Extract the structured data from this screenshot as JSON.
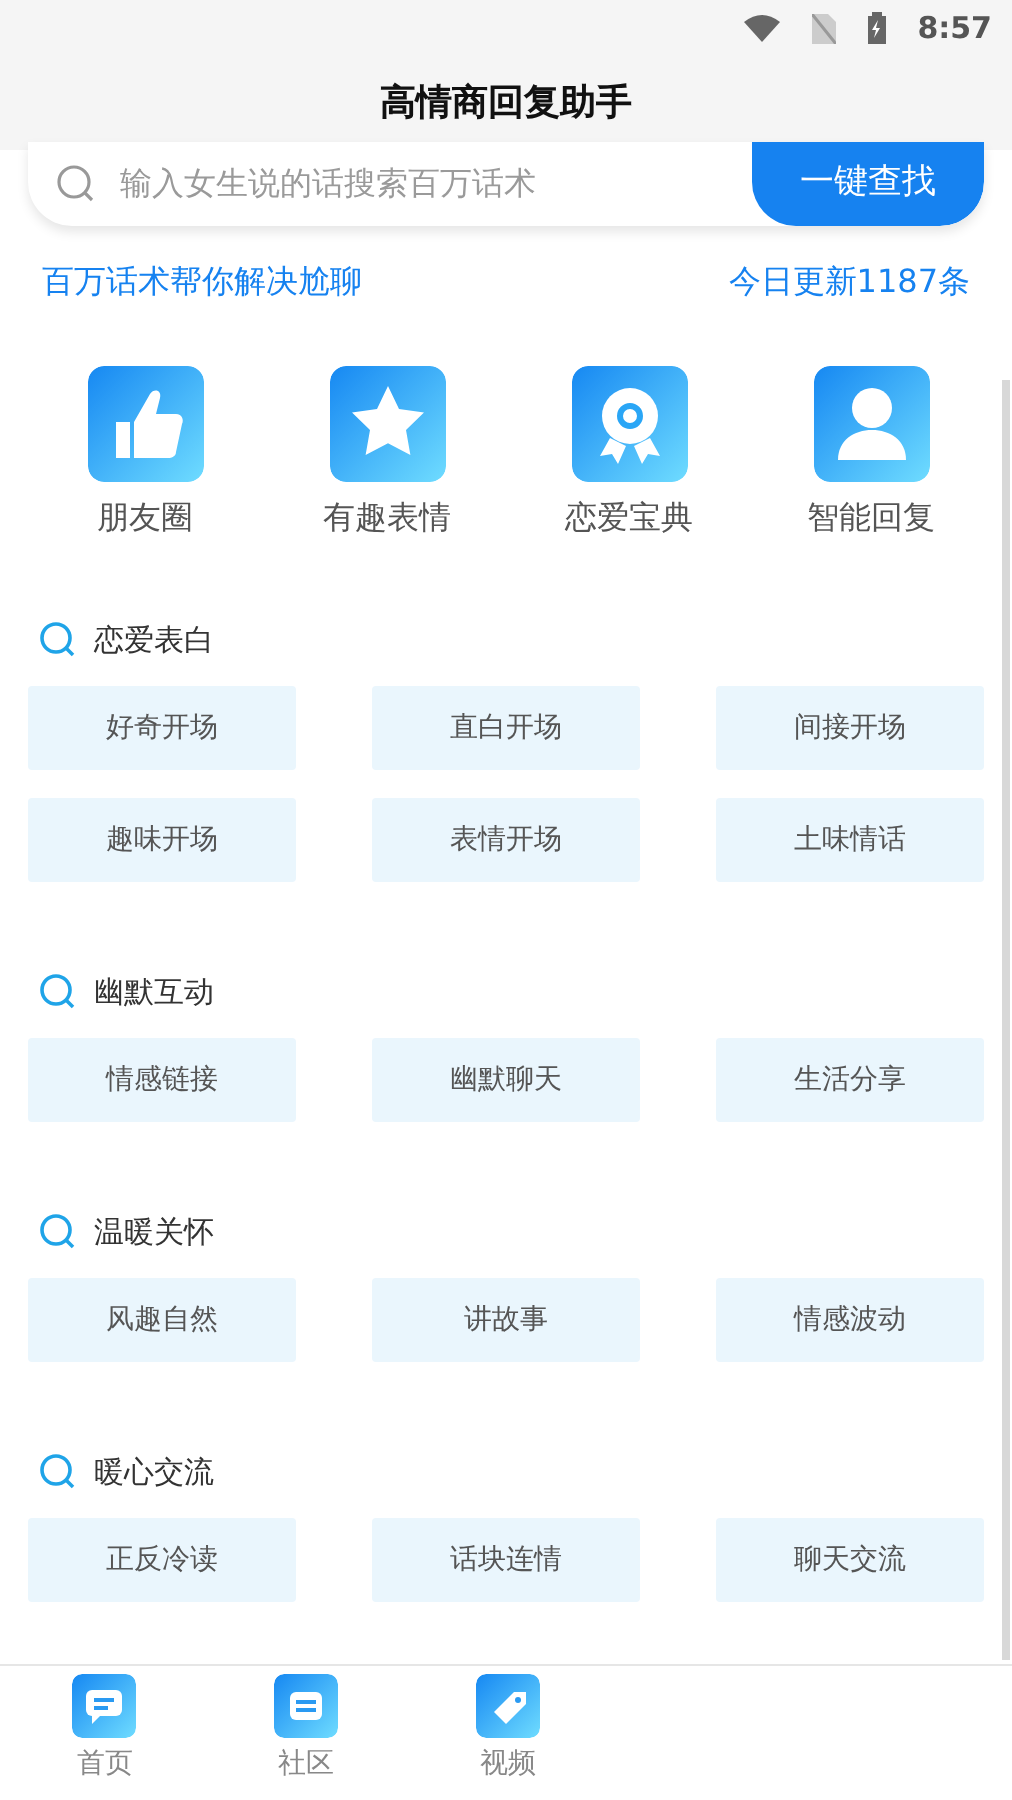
{
  "status_bar": {
    "time": "8:57"
  },
  "title": "高情商回复助手",
  "search": {
    "placeholder": "输入女生说的话搜索百万话术",
    "button": "一键查找"
  },
  "info": {
    "left": "百万话术帮你解决尬聊",
    "right": "今日更新1187条"
  },
  "features": [
    {
      "kind": "thumb",
      "label": "朋友圈"
    },
    {
      "kind": "star",
      "label": "有趣表情"
    },
    {
      "kind": "medal",
      "label": "恋爱宝典"
    },
    {
      "kind": "person",
      "label": "智能回复"
    }
  ],
  "sections": [
    {
      "title": "恋爱表白",
      "items": [
        "好奇开场",
        "直白开场",
        "间接开场",
        "趣味开场",
        "表情开场",
        "土味情话"
      ]
    },
    {
      "title": "幽默互动",
      "items": [
        "情感链接",
        "幽默聊天",
        "生活分享"
      ]
    },
    {
      "title": "温暖关怀",
      "items": [
        "风趣自然",
        "讲故事",
        "情感波动"
      ]
    },
    {
      "title": "暖心交流",
      "items": [
        "正反冷读",
        "话块连情",
        "聊天交流"
      ]
    }
  ],
  "bottom_nav": [
    {
      "kind": "chat",
      "label": "首页"
    },
    {
      "kind": "list",
      "label": "社区"
    },
    {
      "kind": "tag",
      "label": "视频"
    }
  ]
}
